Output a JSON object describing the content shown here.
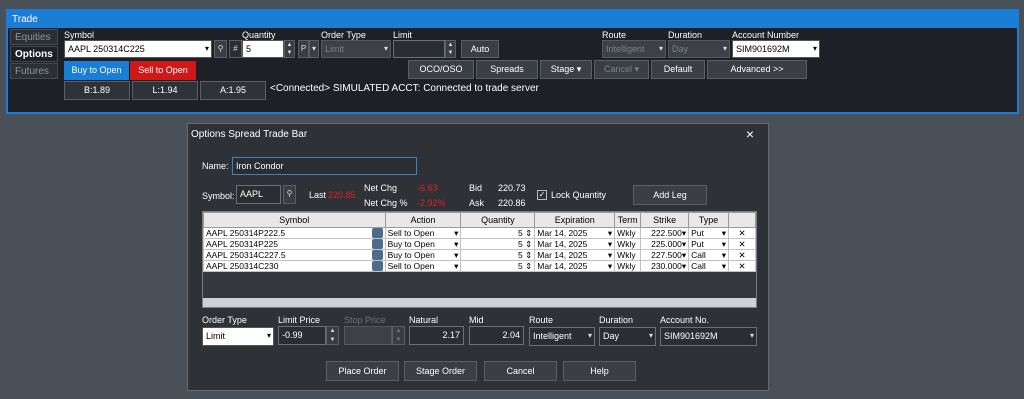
{
  "trade": {
    "title": "Trade",
    "tabs": [
      "Equities",
      "Options",
      "Futures"
    ],
    "labels": {
      "symbol": "Symbol",
      "quantity": "Quantity",
      "order_type": "Order Type",
      "limit": "Limit",
      "route": "Route",
      "duration": "Duration",
      "account_number": "Account Number"
    },
    "symbol_value": "AAPL 250314C225",
    "hash": "#",
    "quantity_value": "5",
    "p_label": "P",
    "order_type_value": "Limit",
    "auto_label": "Auto",
    "route_value": "Intelligent",
    "duration_value": "Day",
    "account_value": "SIM901692M",
    "buy_label": "Buy to Open",
    "sell_label": "Sell to Open",
    "buttons": {
      "oco": "OCO/OSO",
      "spreads": "Spreads",
      "stage": "Stage",
      "cancel": "Cancel",
      "default": "Default",
      "advanced": "Advanced >>"
    },
    "quotes": {
      "bid": "B:1.89",
      "last": "L:1.94",
      "ask": "A:1.95"
    },
    "status": "<Connected> SIMULATED ACCT: Connected to trade server"
  },
  "dialog": {
    "title": "Options Spread Trade Bar",
    "close": "×",
    "name_label": "Name:",
    "name_value": "Iron Condor",
    "symbol_label": "Symbol:",
    "symbol_value": "AAPL",
    "last_label": "Last",
    "last_value": "220.85",
    "netchg_label": "Net Chg",
    "netchg_value": "-6.63",
    "netchgpct_label": "Net Chg %",
    "netchgpct_value": "-2.92%",
    "bid_label": "Bid",
    "bid_value": "220.73",
    "ask_label": "Ask",
    "ask_value": "220.86",
    "lock_label": "Lock Quantity",
    "add_leg": "Add Leg",
    "columns": [
      "Symbol",
      "Action",
      "Quantity",
      "Expiration",
      "Term",
      "Strike",
      "Type"
    ],
    "legs": [
      {
        "symbol": "AAPL 250314P222.5",
        "action": "Sell to Open",
        "qty": "5",
        "exp": "Mar 14, 2025",
        "term": "Wkly",
        "strike": "222.500",
        "type": "Put"
      },
      {
        "symbol": "AAPL 250314P225",
        "action": "Buy to Open",
        "qty": "5",
        "exp": "Mar 14, 2025",
        "term": "Wkly",
        "strike": "225.000",
        "type": "Put"
      },
      {
        "symbol": "AAPL 250314C227.5",
        "action": "Buy to Open",
        "qty": "5",
        "exp": "Mar 14, 2025",
        "term": "Wkly",
        "strike": "227.500",
        "type": "Call"
      },
      {
        "symbol": "AAPL 250314C230",
        "action": "Sell to Open",
        "qty": "5",
        "exp": "Mar 14, 2025",
        "term": "Wkly",
        "strike": "230.000",
        "type": "Call"
      }
    ],
    "bottom_labels": {
      "order_type": "Order Type",
      "limit_price": "Limit Price",
      "stop_price": "Stop Price",
      "natural": "Natural",
      "mid": "Mid",
      "route": "Route",
      "duration": "Duration",
      "account": "Account No."
    },
    "order_type_value": "Limit",
    "limit_price_value": "-0.99",
    "natural_value": "2.17",
    "mid_value": "2.04",
    "route_value": "Intelligent",
    "duration_value": "Day",
    "account_value": "SIM901692M",
    "buttons": {
      "place": "Place Order",
      "stage": "Stage Order",
      "cancel": "Cancel",
      "help": "Help"
    }
  },
  "colors": {
    "accent": "#1b7ed6",
    "buy": "#1b7ed6",
    "sell": "#d11818",
    "negative": "#e02020"
  }
}
